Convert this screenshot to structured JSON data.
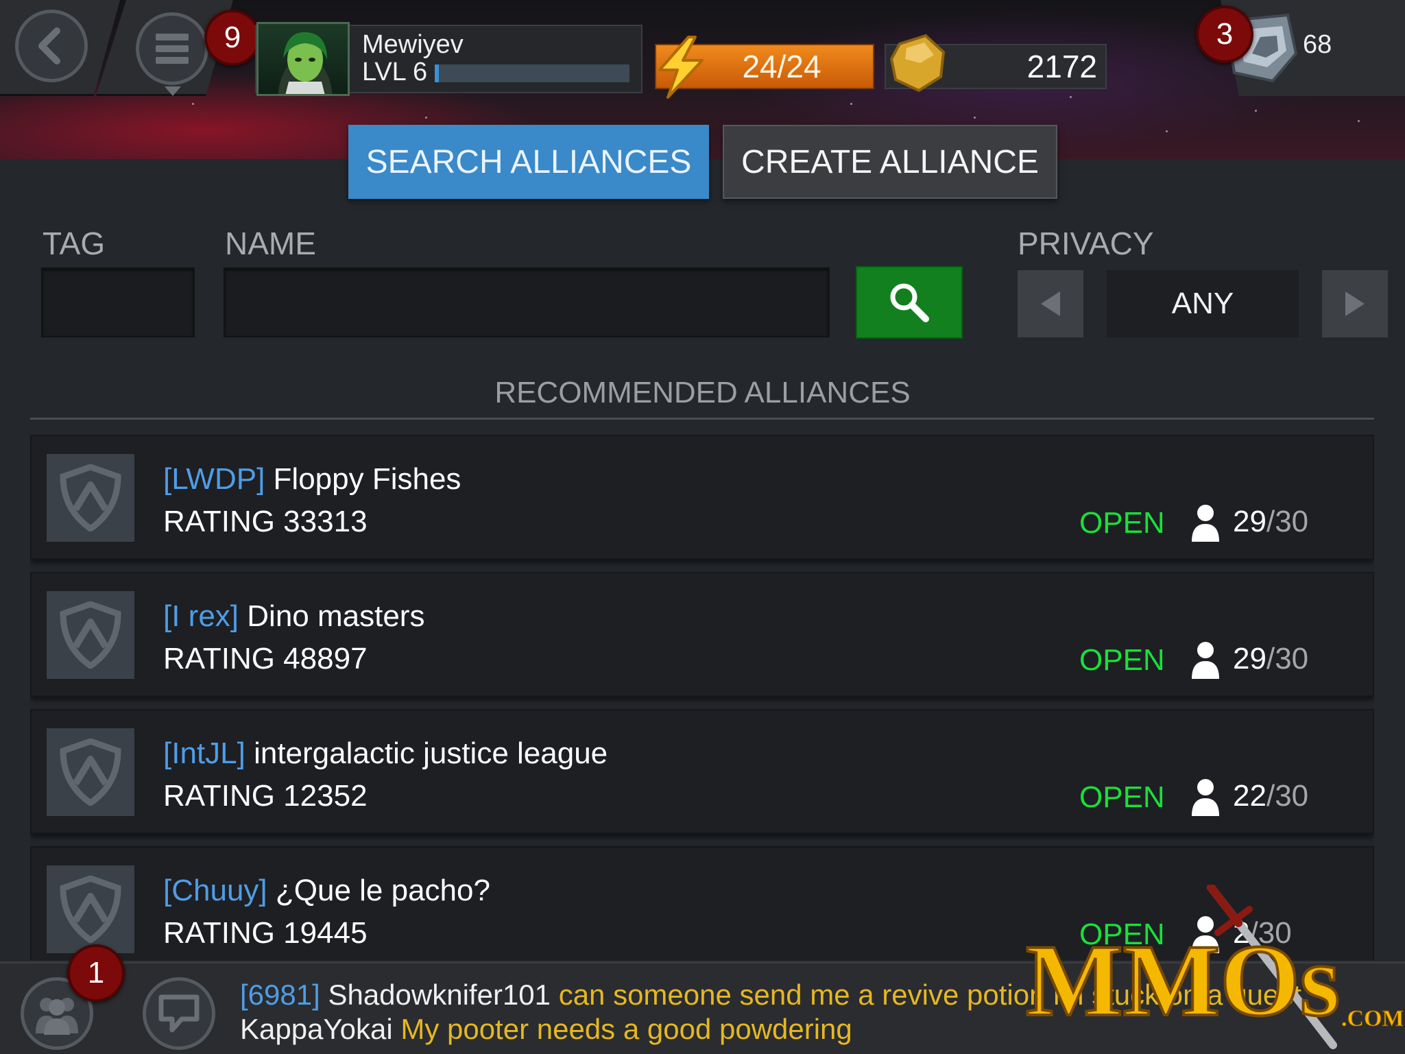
{
  "header": {
    "menu_badge": "9",
    "player_name": "Mewiyev",
    "player_level": "LVL 6",
    "xp_progress": 0.02,
    "energy": "24/24",
    "gold": "2172",
    "units_badge": "3",
    "units": "68"
  },
  "tabs": {
    "search_label": "SEARCH ALLIANCES",
    "create_label": "CREATE ALLIANCE"
  },
  "form": {
    "tag_label": "TAG",
    "name_label": "NAME",
    "privacy_label": "PRIVACY",
    "privacy_value": "ANY"
  },
  "recommended": {
    "title": "RECOMMENDED ALLIANCES",
    "alliances": [
      {
        "tag": "[LWDP]",
        "name": "Floppy Fishes",
        "rating": "RATING 33313",
        "status": "OPEN",
        "members": "29",
        "capacity": "30"
      },
      {
        "tag": "[I rex]",
        "name": "Dino masters",
        "rating": "RATING 48897",
        "status": "OPEN",
        "members": "29",
        "capacity": "30"
      },
      {
        "tag": "[IntJL]",
        "name": "intergalactic justice league",
        "rating": "RATING 12352",
        "status": "OPEN",
        "members": "22",
        "capacity": "30"
      },
      {
        "tag": "[Chuuy]",
        "name": "¿Que le pacho?",
        "rating": "RATING 19445",
        "status": "OPEN",
        "members": "2",
        "capacity": "30"
      }
    ]
  },
  "chat": {
    "alliance_badge": "1",
    "messages": [
      {
        "tag": "[6981]",
        "user": "Shadowknifer101",
        "text": "can someone send me a revive potion im stuck on a quest"
      },
      {
        "tag": "",
        "user": "KappaYokai",
        "text": "My pooter needs a good powdering"
      }
    ]
  },
  "watermark": {
    "text": "MMOs",
    "suffix": ".COM"
  },
  "colors": {
    "accent_blue": "#3a89c9",
    "open_green": "#19e03a",
    "search_green": "#12801e",
    "energy_orange": "#f08a1c",
    "chat_yellow": "#e6b820",
    "tag_blue": "#4f9de6"
  },
  "icons": {
    "back": "back-arrow-icon",
    "menu": "hamburger-menu-icon",
    "energy": "lightning-icon",
    "gold": "gold-nugget-icon",
    "units": "units-crystal-icon",
    "search": "magnifier-icon",
    "emblem": "shield-emblem-icon",
    "member": "person-icon",
    "alliance": "alliance-group-icon",
    "chat": "chat-bubble-icon"
  }
}
